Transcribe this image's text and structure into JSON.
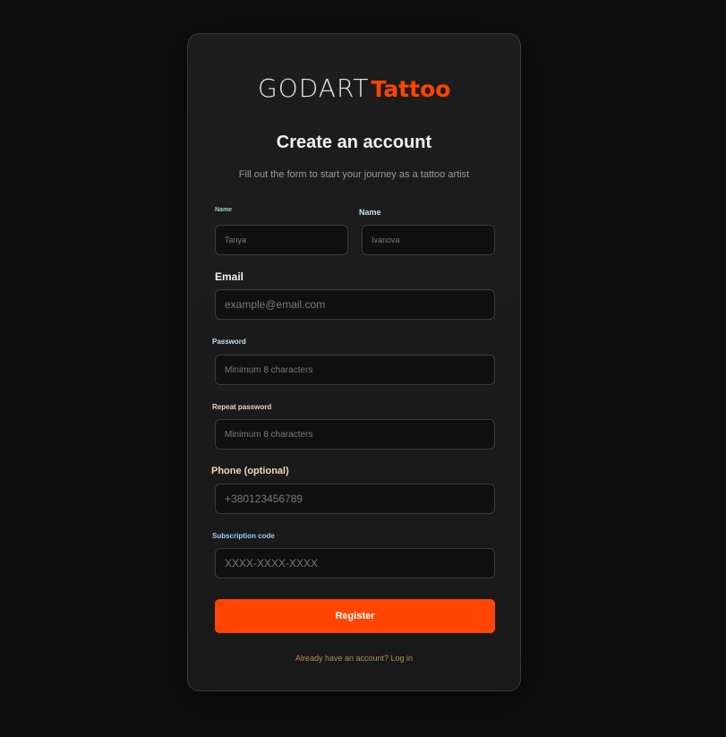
{
  "brand": {
    "part1": "GODART",
    "part2": "Tattoo",
    "accent": "#ff4500"
  },
  "header": {
    "title": "Create an account",
    "subtitle": "Fill out the form to start your journey as a tattoo artist"
  },
  "form": {
    "first_name": {
      "label": "Name",
      "placeholder": "Tanya"
    },
    "last_name": {
      "label": "Name",
      "placeholder": "Ivanova"
    },
    "email": {
      "label": "Email",
      "placeholder": "example@email.com"
    },
    "password": {
      "label": "Password",
      "placeholder": "Minimum 8 characters"
    },
    "repeat_password": {
      "label": "Repeat password",
      "placeholder": "Minimum 8 characters"
    },
    "phone": {
      "label": "Phone (optional)",
      "placeholder": "+380123456789"
    },
    "subscription": {
      "label": "Subscription code",
      "placeholder": "XXXX-XXXX-XXXX"
    },
    "submit_label": "Register"
  },
  "footer": {
    "text": "Already have an account?",
    "link": "Log in"
  }
}
